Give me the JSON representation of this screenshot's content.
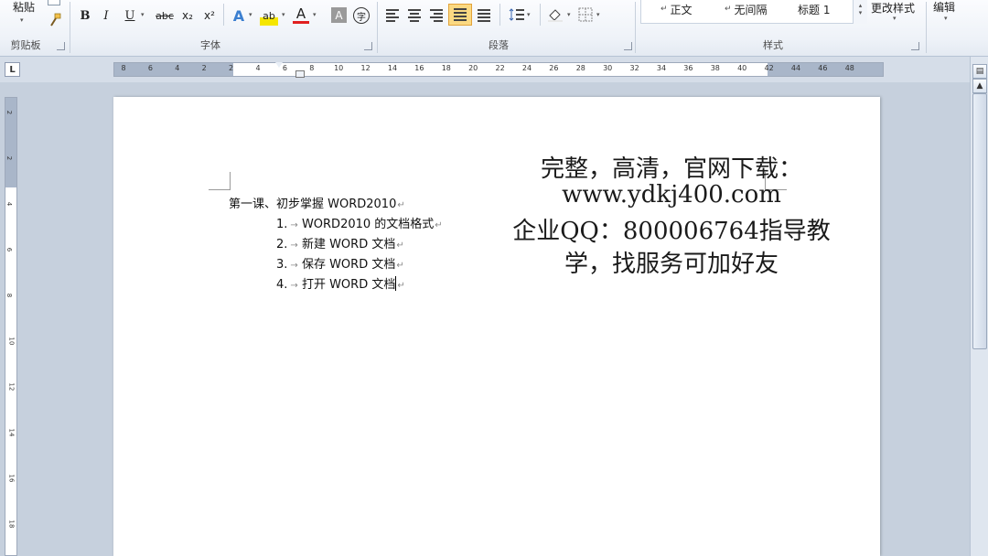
{
  "ribbon": {
    "clipboard": {
      "paste_label": "粘贴",
      "caption": "剪贴板"
    },
    "font": {
      "caption": "字体",
      "bold": "B",
      "italic": "I",
      "underline": "U",
      "strike": "abc",
      "subscript": "x₂",
      "superscript": "x²",
      "text_effects": "A",
      "highlight": "ab",
      "font_color": "A",
      "char_shading": "A",
      "enclose": "字"
    },
    "paragraph": {
      "caption": "段落"
    },
    "styles": {
      "caption": "样式",
      "items": [
        "正文",
        "无间隔",
        "标题 1"
      ],
      "change_styles": "更改样式"
    },
    "editing": {
      "label": "编辑"
    }
  },
  "ruler": {
    "h_numbers": [
      "8",
      "6",
      "4",
      "2",
      "2",
      "4",
      "6",
      "8",
      "10",
      "12",
      "14",
      "16",
      "18",
      "20",
      "22",
      "24",
      "26",
      "28",
      "30",
      "32",
      "34",
      "36",
      "38",
      "40",
      "42",
      "44",
      "46",
      "48"
    ],
    "v_numbers": [
      "2",
      "2",
      "4",
      "6",
      "8",
      "10",
      "12",
      "14",
      "16",
      "18"
    ]
  },
  "document": {
    "heading": "第一课、初步掌握 WORD2010",
    "items": [
      {
        "num": "1.",
        "text": "WORD2010 的文档格式"
      },
      {
        "num": "2.",
        "text": "新建 WORD 文档"
      },
      {
        "num": "3.",
        "text": "保存 WORD 文档"
      },
      {
        "num": "4.",
        "text": "打开 WORD 文档"
      }
    ],
    "paragraph_mark": "↵",
    "tab_arrow": "→"
  },
  "watermark": {
    "line1": "完整，高清，官网下载：",
    "line2": "www.ydkj400.com",
    "line3": "企业QQ：800006764指导教",
    "line4": "学，找服务可加好友"
  },
  "icons": {
    "ruler_corner": "tab-selector-icon",
    "scroll_up": "scroll-up-icon",
    "scroll_down": "scroll-down-icon"
  },
  "colors": {
    "ribbon_bg": "#eef2f8",
    "doc_bg": "#c6d0dd",
    "page": "#ffffff",
    "ruler_margin": "#a9b6c9"
  }
}
